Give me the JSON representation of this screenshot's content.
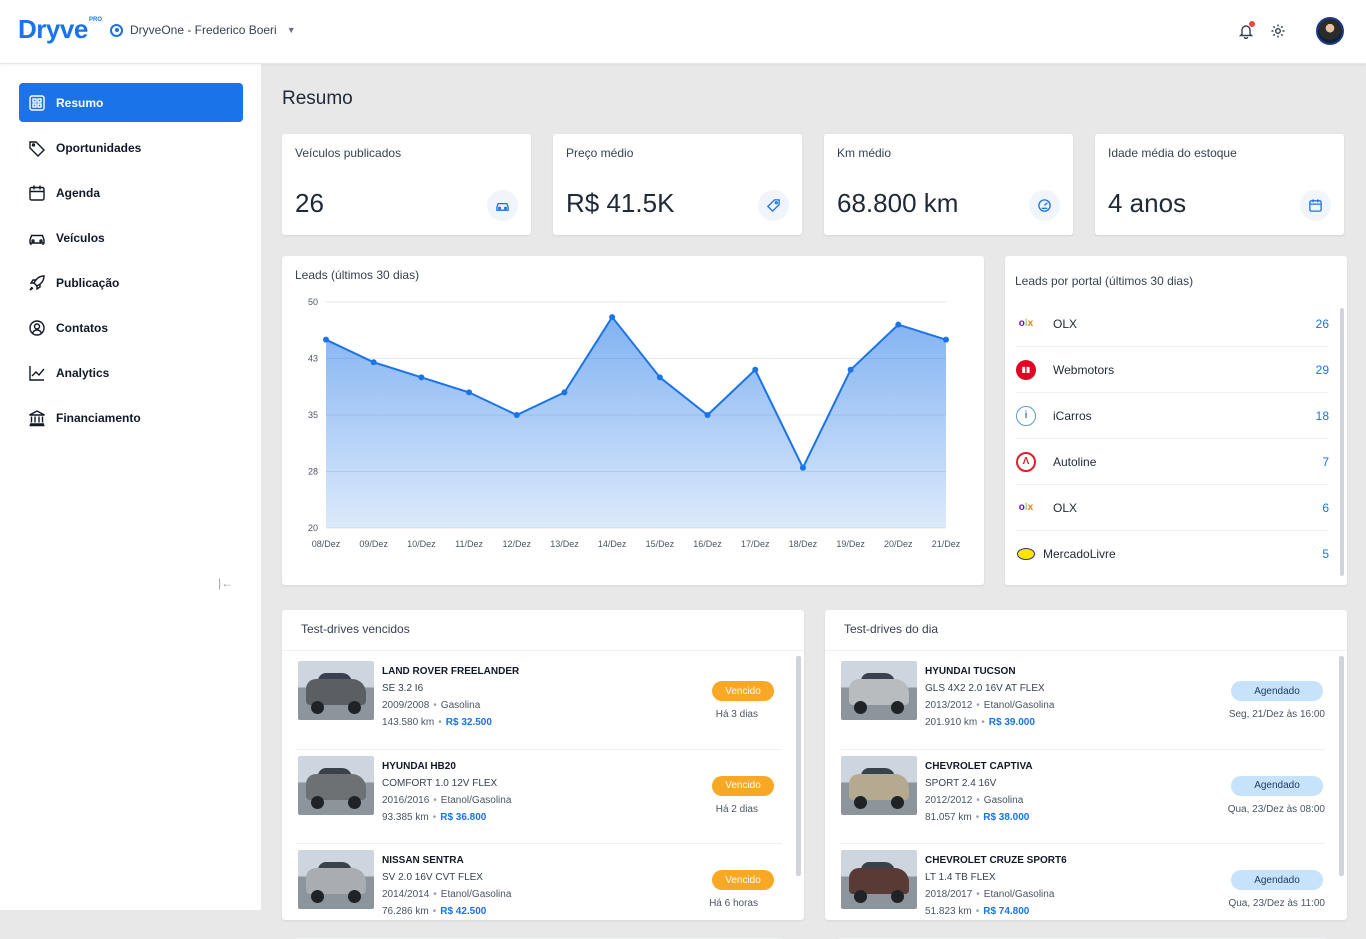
{
  "header": {
    "logo": "Dryve",
    "logo_badge": "PRO",
    "account": "DryveOne - Frederico Boeri"
  },
  "sidebar": {
    "items": [
      {
        "label": "Resumo",
        "icon": "dashboard-icon"
      },
      {
        "label": "Oportunidades",
        "icon": "tag-icon"
      },
      {
        "label": "Agenda",
        "icon": "calendar-icon"
      },
      {
        "label": "Veículos",
        "icon": "car-icon"
      },
      {
        "label": "Publicação",
        "icon": "rocket-icon"
      },
      {
        "label": "Contatos",
        "icon": "user-circle-icon"
      },
      {
        "label": "Analytics",
        "icon": "trend-icon"
      },
      {
        "label": "Financiamento",
        "icon": "bank-icon"
      }
    ]
  },
  "page": {
    "title": "Resumo"
  },
  "stats": [
    {
      "label": "Veículos publicados",
      "value": "26",
      "icon": "car-icon"
    },
    {
      "label": "Preço médio",
      "value": "R$ 41.5K",
      "icon": "price-tag-icon"
    },
    {
      "label": "Km médio",
      "value": "68.800 km",
      "icon": "speedometer-icon"
    },
    {
      "label": "Idade média do estoque",
      "value": "4 anos",
      "icon": "calendar-icon"
    }
  ],
  "leads_chart": {
    "title": "Leads (últimos 30 dias)"
  },
  "chart_data": {
    "type": "area",
    "title": "Leads (últimos 30 dias)",
    "categories": [
      "08/Dez",
      "09/Dez",
      "10/Dez",
      "11/Dez",
      "12/Dez",
      "13/Dez",
      "14/Dez",
      "15/Dez",
      "16/Dez",
      "17/Dez",
      "18/Dez",
      "19/Dez",
      "20/Dez",
      "21/Dez"
    ],
    "values": [
      45,
      42,
      40,
      38,
      35,
      38,
      48,
      40,
      35,
      41,
      28,
      41,
      47,
      45
    ],
    "yticks": [
      "50",
      "43",
      "35",
      "28",
      "20"
    ],
    "ylim": [
      20,
      50
    ],
    "grid": true,
    "color": "#1a73e8"
  },
  "portals": {
    "title": "Leads por portal (últimos 30 dias)",
    "items": [
      {
        "name": "OLX",
        "count": "26",
        "logo": "olx"
      },
      {
        "name": "Webmotors",
        "count": "29",
        "logo": "webmotors"
      },
      {
        "name": "iCarros",
        "count": "18",
        "logo": "icarros"
      },
      {
        "name": "Autoline",
        "count": "7",
        "logo": "autoline"
      },
      {
        "name": "OLX",
        "count": "6",
        "logo": "olx"
      },
      {
        "name": "MercadoLivre",
        "count": "5",
        "logo": "mercadolivre"
      }
    ]
  },
  "overdue": {
    "title": "Test-drives vencidos",
    "items": [
      {
        "name": "LAND ROVER FREELANDER",
        "version": "SE 3.2 I6",
        "year": "2009/2008",
        "fuel": "Gasolina",
        "km": "143.580 km",
        "price": "R$ 32.500",
        "status": "Vencido",
        "when": "Há 3 dias",
        "car_color": "#5b5f63"
      },
      {
        "name": "HYUNDAI HB20",
        "version": "COMFORT 1.0 12V FLEX",
        "year": "2016/2016",
        "fuel": "Etanol/Gasolina",
        "km": "93.385 km",
        "price": "R$ 36.800",
        "status": "Vencido",
        "when": "Há 2 dias",
        "car_color": "#6e7174"
      },
      {
        "name": "NISSAN SENTRA",
        "version": "SV 2.0 16V CVT FLEX",
        "year": "2014/2014",
        "fuel": "Etanol/Gasolina",
        "km": "76.286 km",
        "price": "R$ 42.500",
        "status": "Vencido",
        "when": "Há 6 horas",
        "car_color": "#a9adb1"
      }
    ]
  },
  "today": {
    "title": "Test-drives do dia",
    "items": [
      {
        "name": "HYUNDAI TUCSON",
        "version": "GLS 4X2 2.0 16V AT FLEX",
        "year": "2013/2012",
        "fuel": "Etanol/Gasolina",
        "km": "201.910 km",
        "price": "R$ 39.000",
        "status": "Agendado",
        "when": "Seg, 21/Dez às 16:00",
        "car_color": "#b9bcbf"
      },
      {
        "name": "CHEVROLET CAPTIVA",
        "version": "SPORT 2.4 16V",
        "year": "2012/2012",
        "fuel": "Gasolina",
        "km": "81.057 km",
        "price": "R$ 38.000",
        "status": "Agendado",
        "when": "Qua, 23/Dez às 08:00",
        "car_color": "#b5a98f"
      },
      {
        "name": "CHEVROLET CRUZE SPORT6",
        "version": "LT 1.4 TB FLEX",
        "year": "2018/2017",
        "fuel": "Etanol/Gasolina",
        "km": "51.823 km",
        "price": "R$ 74.800",
        "status": "Agendado",
        "when": "Qua, 23/Dez às 11:00",
        "car_color": "#5a3a34"
      }
    ]
  }
}
